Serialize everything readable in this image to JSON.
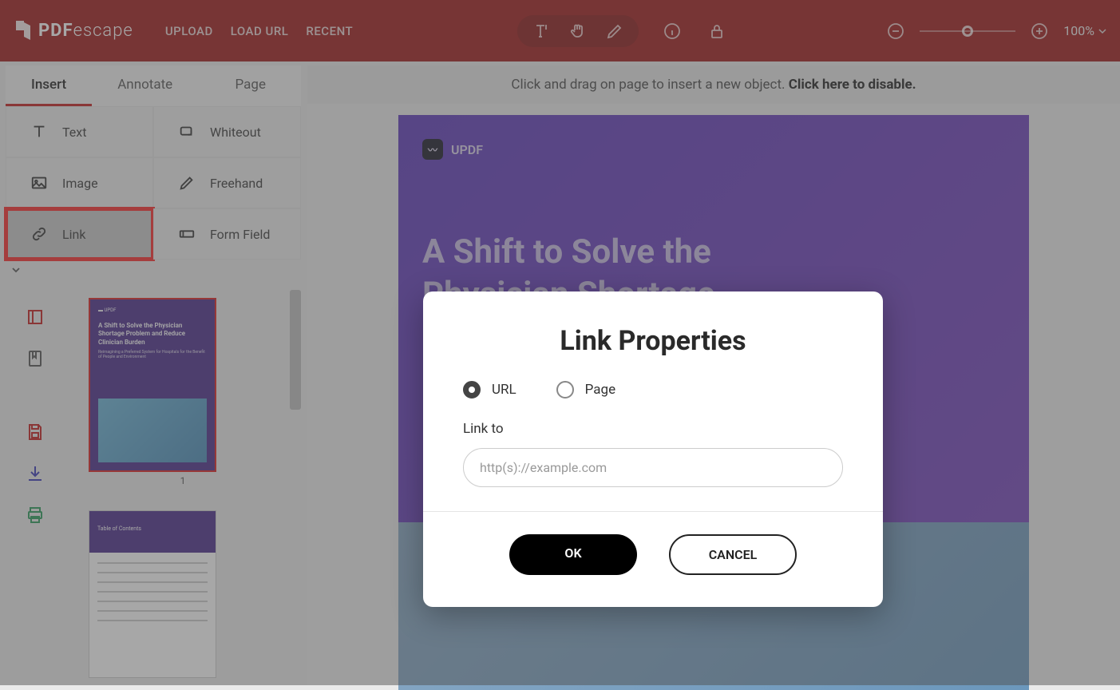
{
  "app": {
    "name_left": "PDF",
    "name_right": "escape"
  },
  "nav": {
    "upload": "UPLOAD",
    "load_url": "LOAD URL",
    "recent": "RECENT"
  },
  "zoom": {
    "value": "100%"
  },
  "tabs": {
    "insert": "Insert",
    "annotate": "Annotate",
    "page": "Page"
  },
  "tools": {
    "text": "Text",
    "whiteout": "Whiteout",
    "image": "Image",
    "freehand": "Freehand",
    "link": "Link",
    "form_field": "Form Field"
  },
  "thumbnails": {
    "page1_label": "1",
    "page1_title": "A Shift to Solve the Physician Shortage Problem and Reduce Clinician Burden",
    "page1_sub": "Reimagining a Preferred System for Hospitals for the Benefit of People and Environment",
    "page2_toc": "Table of Contents"
  },
  "hint": {
    "text": "Click and drag on page to insert a new object. ",
    "action": "Click here to disable."
  },
  "document": {
    "brand": "UPDF",
    "h1_line1": "A Shift to Solve the",
    "h1_line2": "Physician Shortage"
  },
  "modal": {
    "title": "Link Properties",
    "opt_url": "URL",
    "opt_page": "Page",
    "field_label": "Link to",
    "placeholder": "http(s)://example.com",
    "ok": "OK",
    "cancel": "CANCEL"
  }
}
